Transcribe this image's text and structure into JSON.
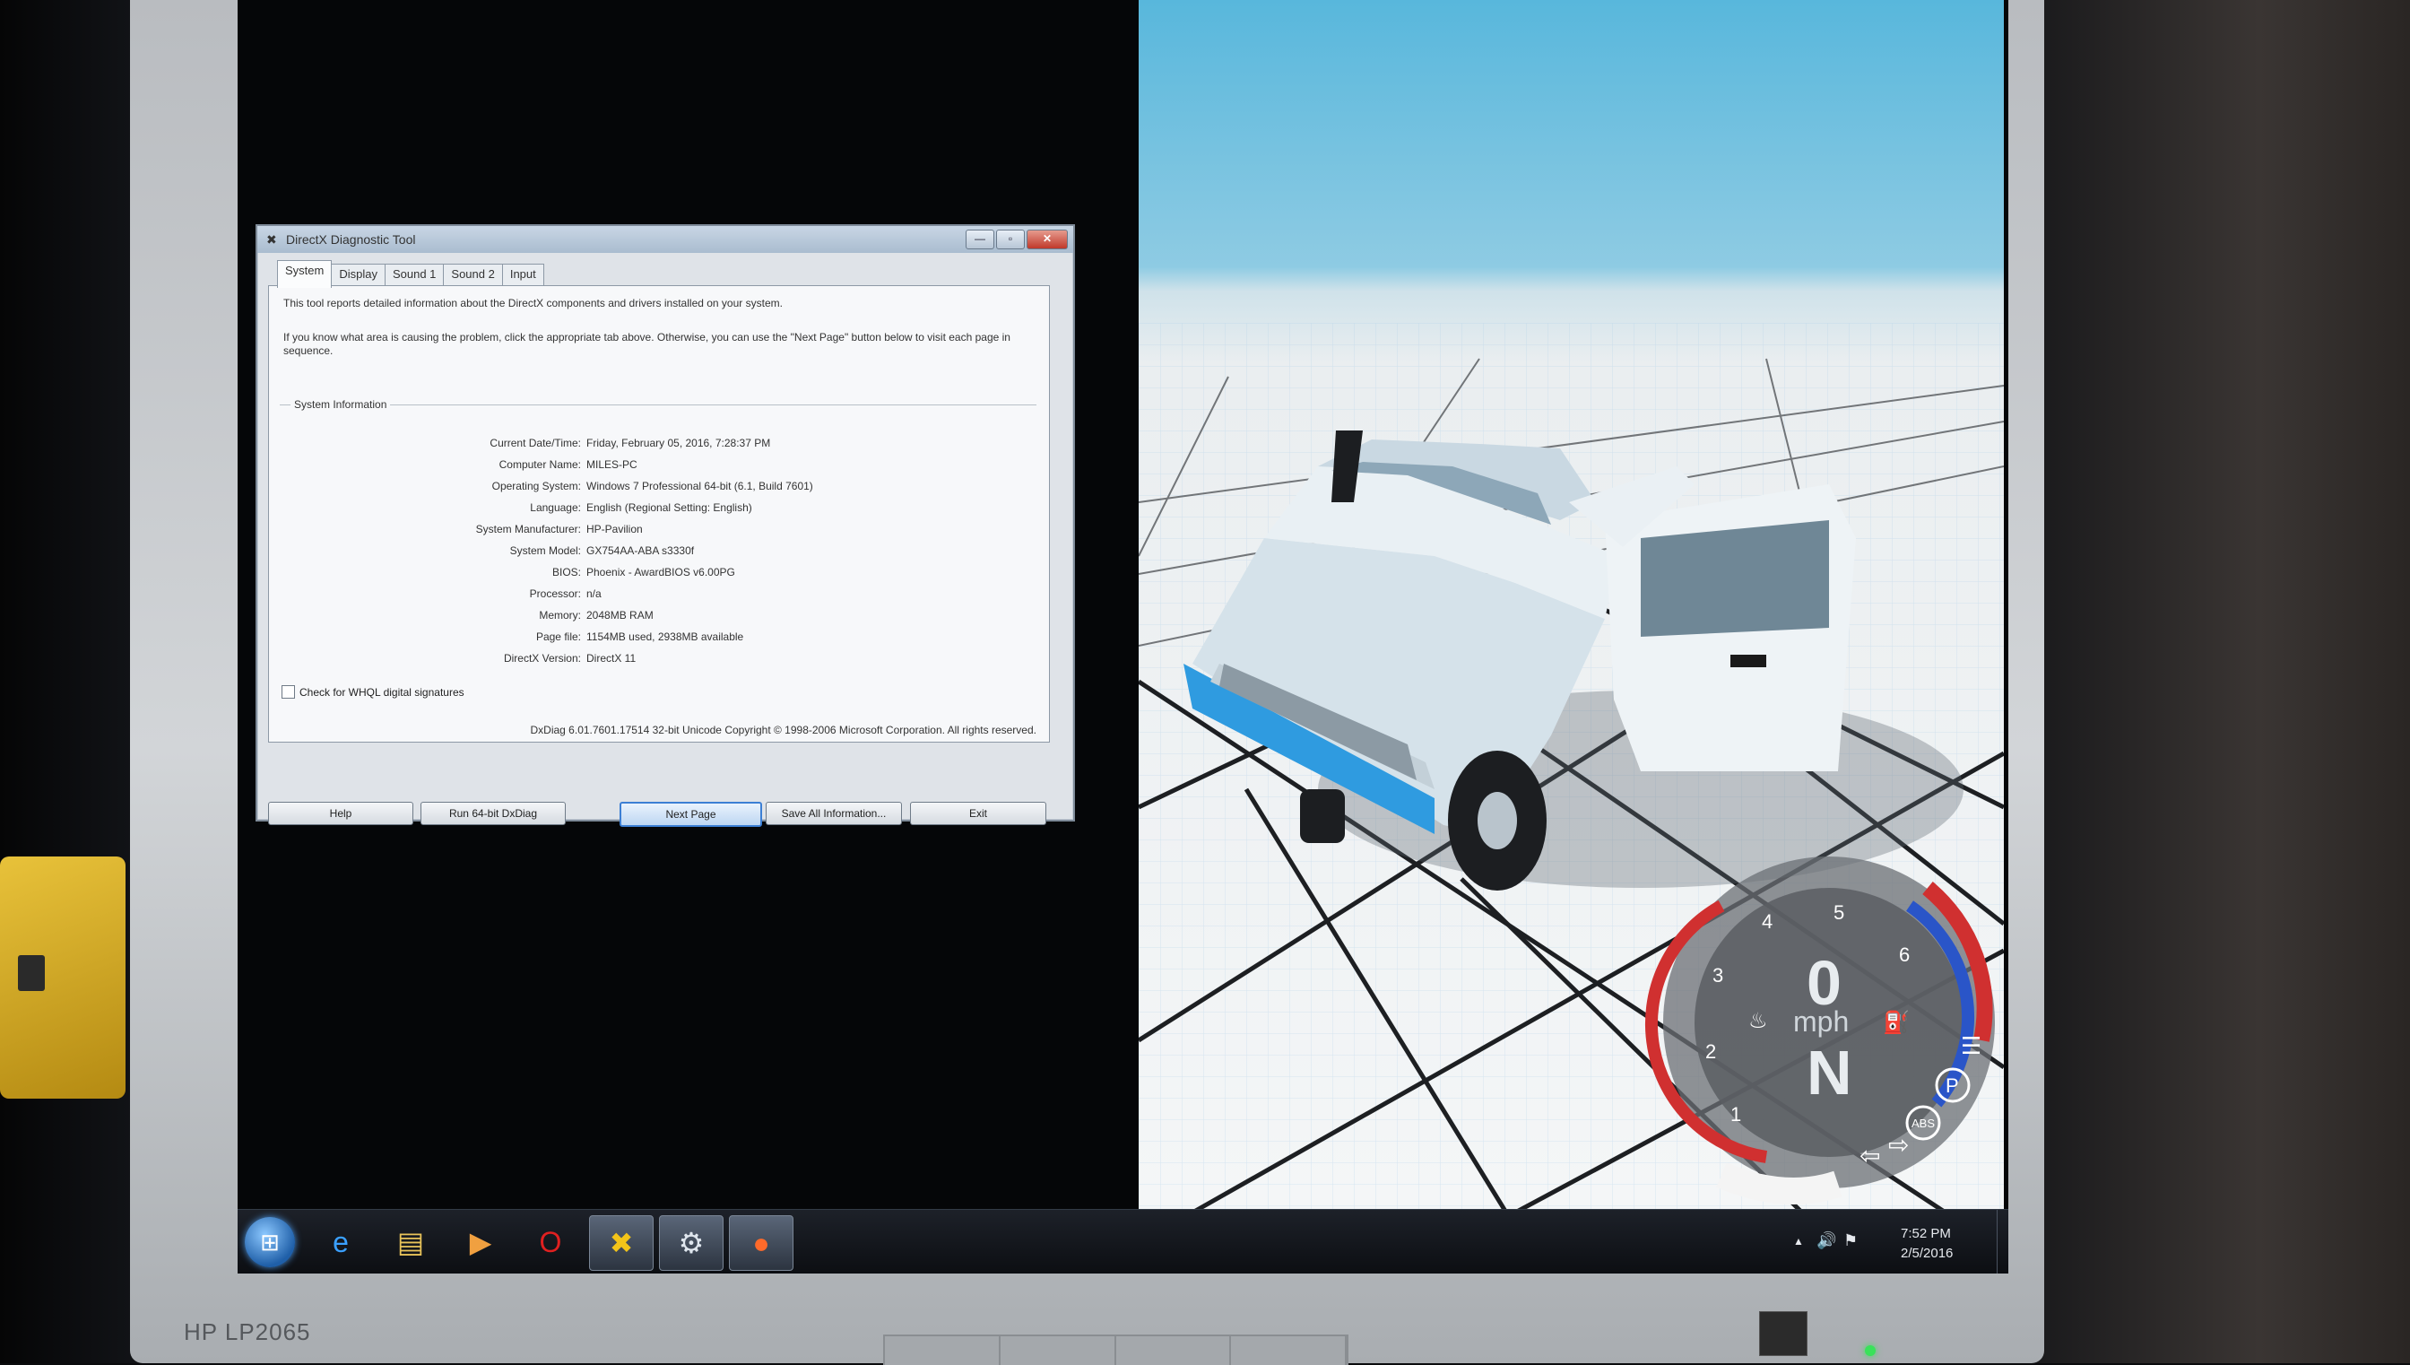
{
  "monitor": {
    "brand": "HP LP2065"
  },
  "dxdiag": {
    "title": "DirectX Diagnostic Tool",
    "tabs": [
      "System",
      "Display",
      "Sound 1",
      "Sound 2",
      "Input"
    ],
    "intro_1": "This tool reports detailed information about the DirectX components and drivers installed on your system.",
    "intro_2": "If you know what area is causing the problem, click the appropriate tab above.  Otherwise, you can use the \"Next Page\" button below to visit each page in sequence.",
    "section_title": "System Information",
    "rows": [
      {
        "label": "Current Date/Time:",
        "value": "Friday, February 05, 2016, 7:28:37 PM"
      },
      {
        "label": "Computer Name:",
        "value": "MILES-PC"
      },
      {
        "label": "Operating System:",
        "value": "Windows 7 Professional 64-bit (6.1, Build 7601)"
      },
      {
        "label": "Language:",
        "value": "English (Regional Setting: English)"
      },
      {
        "label": "System Manufacturer:",
        "value": "HP-Pavilion"
      },
      {
        "label": "System Model:",
        "value": "GX754AA-ABA s3330f"
      },
      {
        "label": "BIOS:",
        "value": "Phoenix - AwardBIOS v6.00PG"
      },
      {
        "label": "Processor:",
        "value": "n/a"
      },
      {
        "label": "Memory:",
        "value": "2048MB RAM"
      },
      {
        "label": "Page file:",
        "value": "1154MB used, 2938MB available"
      },
      {
        "label": "DirectX Version:",
        "value": "DirectX 11"
      }
    ],
    "whql_label": "Check for WHQL digital signatures",
    "whql_checked": false,
    "copyright": "DxDiag 6.01.7601.17514 32-bit Unicode  Copyright © 1998-2006 Microsoft Corporation.  All rights reserved.",
    "buttons": {
      "help": "Help",
      "run64": "Run 64-bit DxDiag",
      "next": "Next Page",
      "save": "Save All Information...",
      "exit": "Exit"
    }
  },
  "game": {
    "speed": "0",
    "speed_unit": "mph",
    "gear": "N",
    "rpm_ticks": [
      "1",
      "2",
      "3",
      "4",
      "5",
      "6"
    ],
    "indicators": [
      "P",
      "ABS"
    ],
    "colors": {
      "sky": "#58b7dc",
      "truck": "#dfe9ef",
      "stripe": "#2f9be0",
      "redline": "#d03030",
      "gauge_blue": "#2a55c8"
    }
  },
  "taskbar": {
    "apps": [
      "start-orb",
      "internet-explorer",
      "file-explorer",
      "media-player",
      "opera",
      "dxdiag",
      "steam",
      "beamng"
    ],
    "time": "7:52 PM",
    "date": "2/5/2016"
  }
}
